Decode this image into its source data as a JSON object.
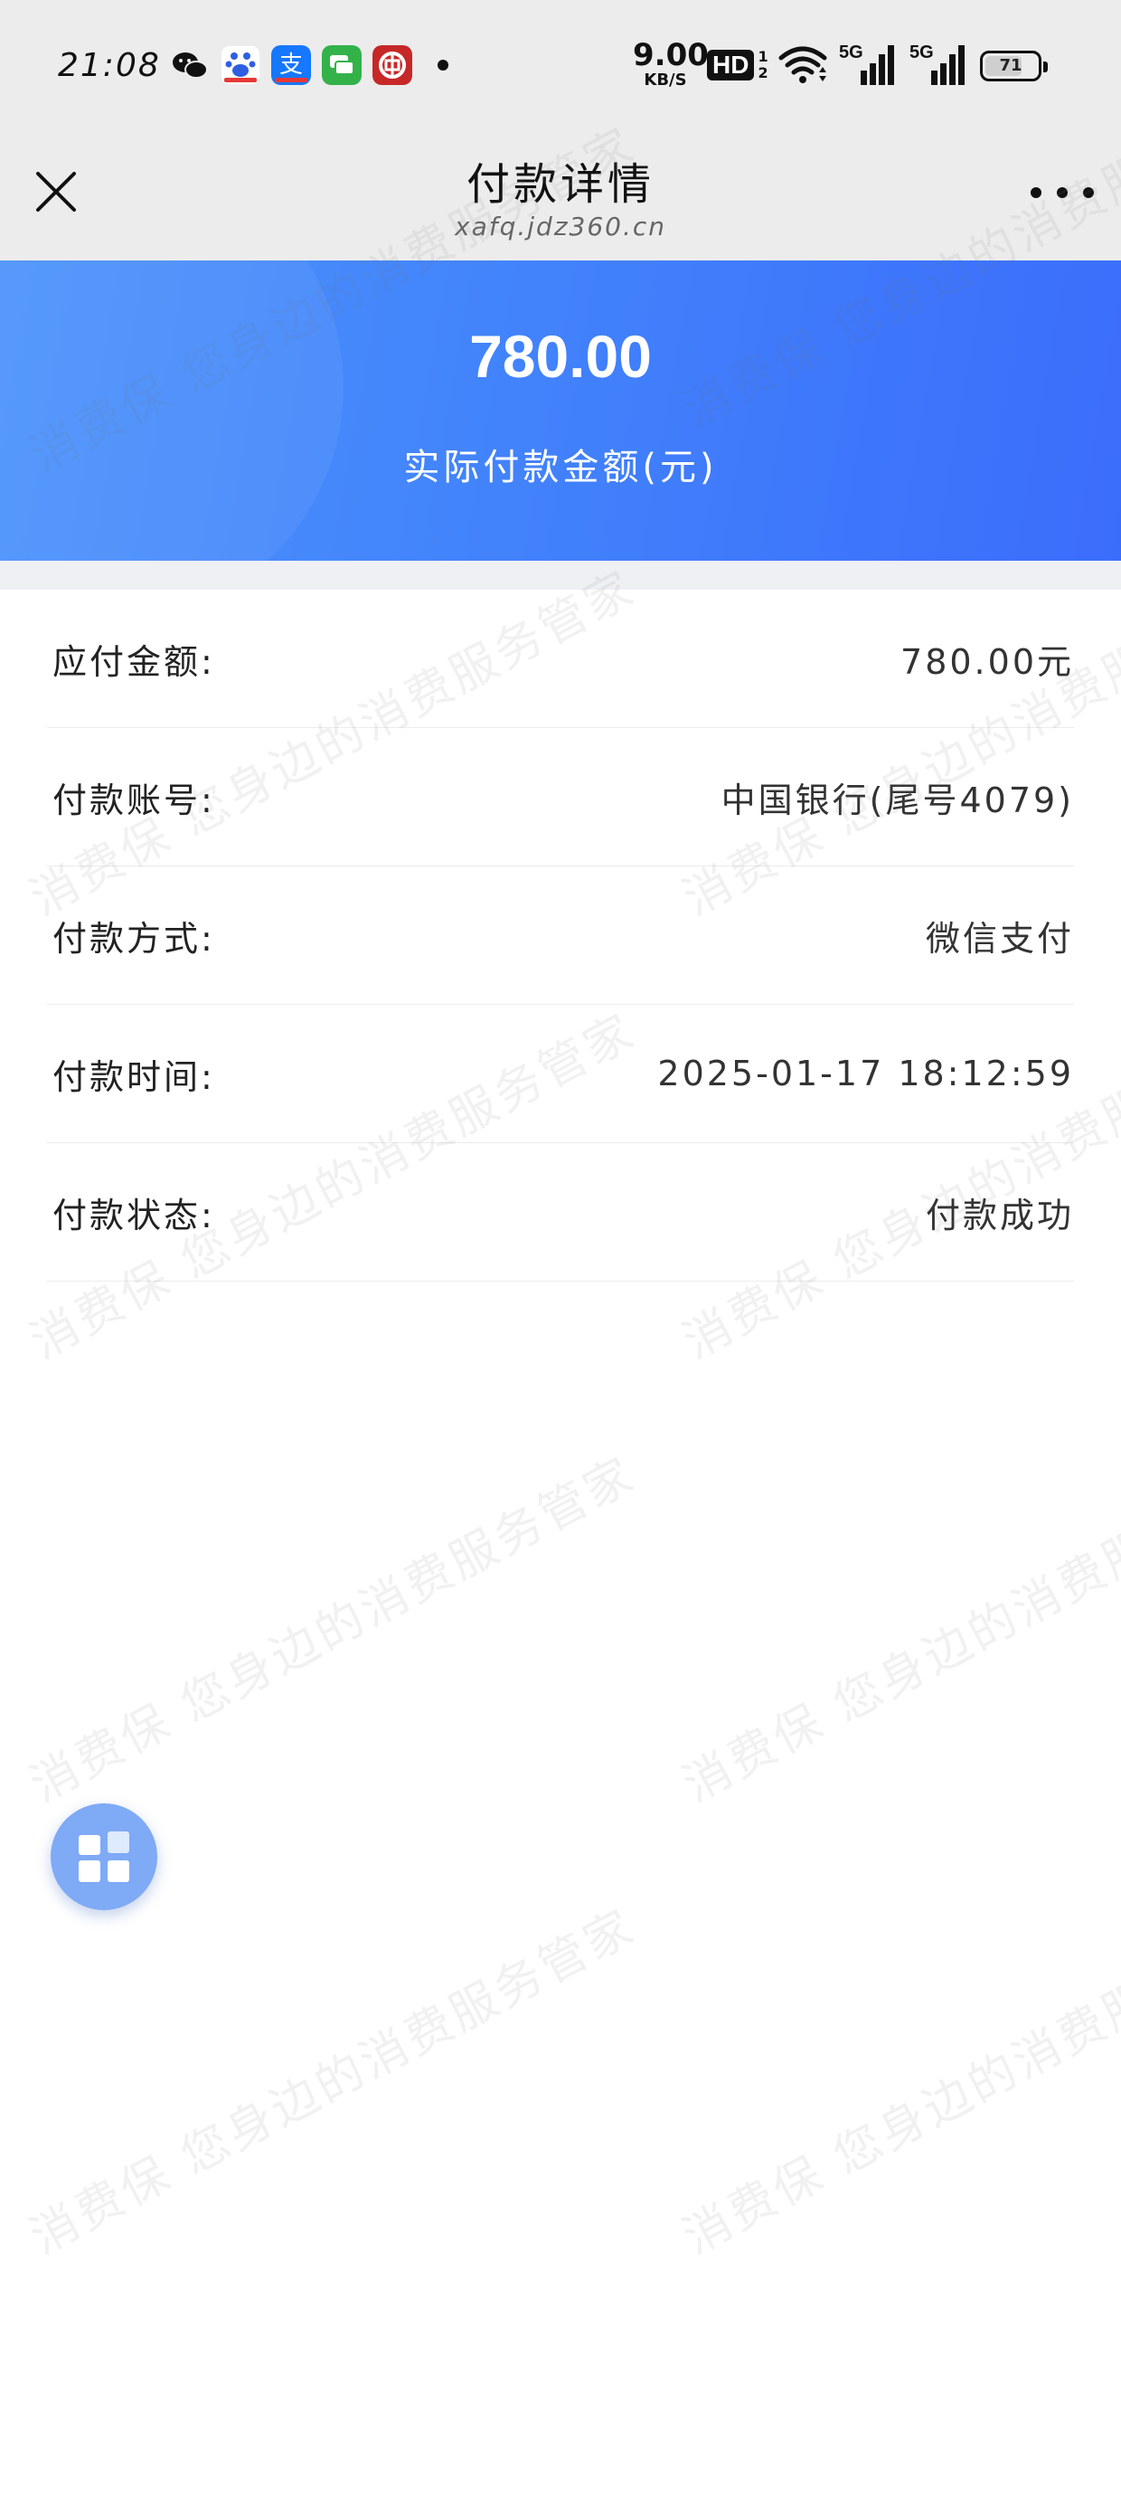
{
  "status_bar": {
    "time": "21:08",
    "net_speed_value": "9.00",
    "net_speed_unit": "KB/S",
    "hd_label": "HD",
    "hd_sim": "1\n2",
    "signal_labels": [
      "5G",
      "5G"
    ],
    "battery_level": "71",
    "app_icons": [
      "wechat-icon",
      "baidu-icon",
      "alipay-icon",
      "messages-icon",
      "bank-of-china-icon"
    ]
  },
  "nav": {
    "title": "付款详情",
    "url": "xafq.jdz360.cn"
  },
  "banner": {
    "amount": "780.00",
    "caption": "实际付款金额(元)"
  },
  "details": [
    {
      "label": "应付金额:",
      "value": "780.00元"
    },
    {
      "label": "付款账号:",
      "value": "中国银行(尾号4079)"
    },
    {
      "label": "付款方式:",
      "value": "微信支付"
    },
    {
      "label": "付款时间:",
      "value": "2025-01-17 18:12:59"
    },
    {
      "label": "付款状态:",
      "value": "付款成功"
    }
  ],
  "watermark_text": "消费保 您身边的消费服务管家",
  "colors": {
    "banner_start": "#4c93fb",
    "banner_end": "#3b6dfb",
    "float_button": "#7eaaf6"
  }
}
